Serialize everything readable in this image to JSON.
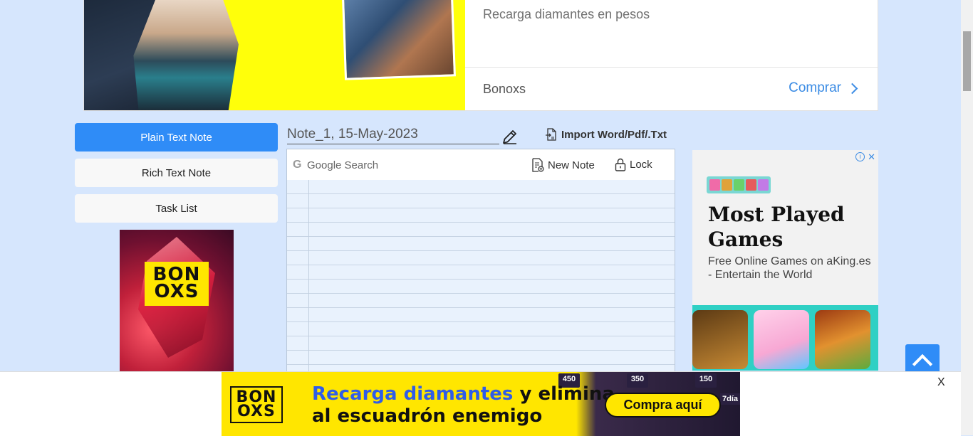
{
  "top_ad": {
    "description": "Recarga diamantes en pesos",
    "brand": "Bonoxs",
    "cta": "Comprar"
  },
  "sidebar": {
    "buttons": [
      {
        "label": "Plain Text Note",
        "active": true
      },
      {
        "label": "Rich Text Note",
        "active": false
      },
      {
        "label": "Task List",
        "active": false
      }
    ],
    "ad_logo": [
      "BON",
      "OXS"
    ]
  },
  "editor": {
    "title": "Note_1, 15-May-2023",
    "import_label": "Import Word/Pdf/.Txt",
    "toolbar": {
      "search_placeholder": "Google Search",
      "new_note_label": "New Note",
      "lock_label": "Lock"
    }
  },
  "right_ad": {
    "headline_1": "Most Played",
    "headline_2": "Games",
    "subtext": "Free Online Games on aKing.es - Entertain the World"
  },
  "bottom_ad": {
    "logo": [
      "BON",
      "OXS"
    ],
    "headline_blue": "Recarga diamantes",
    "headline_rest_1": " y elimina",
    "headline_line_2": "al escuadrón enemigo",
    "cta": "Compra aquí",
    "gem_counts": [
      "450",
      "350",
      "150"
    ],
    "tag": "7día",
    "close_label": "X"
  },
  "colors": {
    "page_bg": "#d6e6fd",
    "primary": "#2f8cf7",
    "link_blue": "#3a8be4",
    "brand_yellow": "#ffe600"
  }
}
